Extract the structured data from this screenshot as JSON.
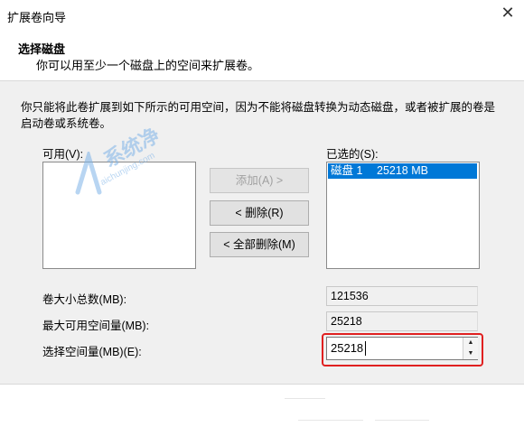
{
  "window": {
    "title": "扩展卷向导",
    "close_glyph": "✕"
  },
  "header": {
    "title": "选择磁盘",
    "subtitle": "你可以用至少一个磁盘上的空间来扩展卷。"
  },
  "description": "你只能将此卷扩展到如下所示的可用空间，因为不能将磁盘转换为动态磁盘，或者被扩展的卷是启动卷或系统卷。",
  "available": {
    "label": "可用(V):",
    "items": []
  },
  "selected": {
    "label": "已选的(S):",
    "items": [
      {
        "disk": "磁盘 1",
        "size": "25218 MB"
      }
    ]
  },
  "buttons": {
    "add": "添加(A) >",
    "remove": "< 删除(R)",
    "remove_all": "< 全部删除(M)"
  },
  "fields": {
    "total_label": "卷大小总数(MB):",
    "total_value": "121536",
    "max_label": "最大可用空间量(MB):",
    "max_value": "25218",
    "select_label": "选择空间量(MB)(E):",
    "select_value": "25218"
  },
  "spin": {
    "up": "▲",
    "down": "▼"
  },
  "watermark": {
    "text": "系统净",
    "url": "aichunjing.com"
  },
  "colors": {
    "selection": "#0078d7",
    "highlight_border": "#e02020",
    "panel_bg": "#f0f0f0"
  }
}
